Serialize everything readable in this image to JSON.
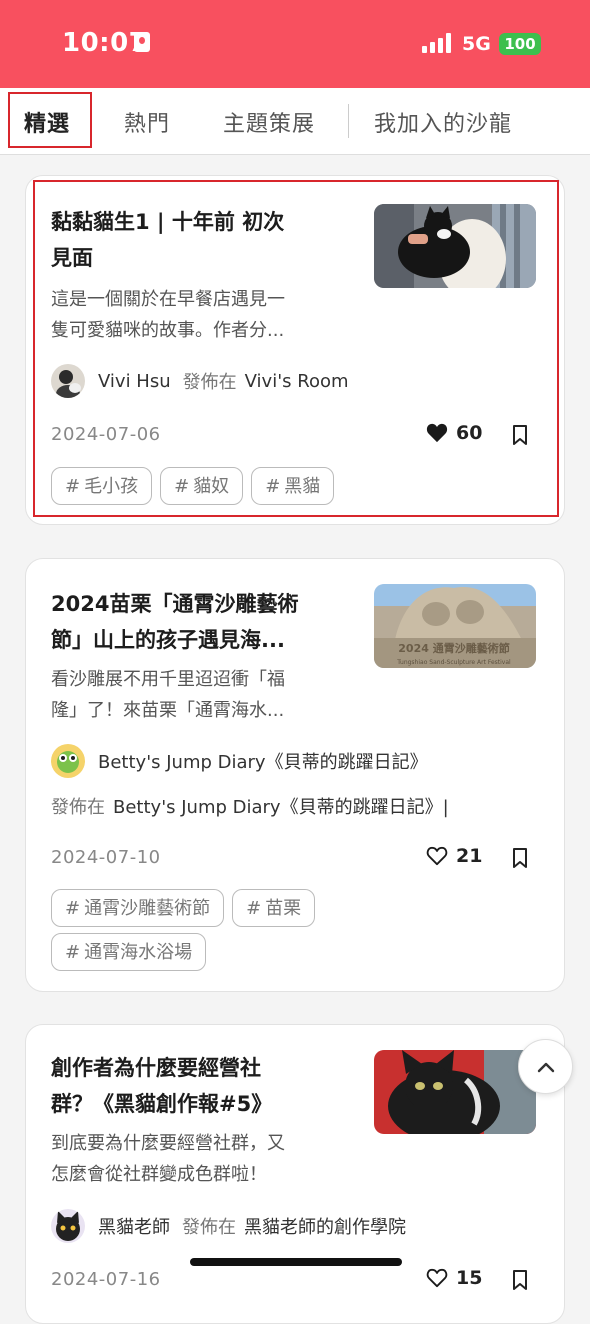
{
  "status_bar": {
    "time": "10:07",
    "network": "5G",
    "battery": "100"
  },
  "tabs": [
    {
      "label": "精選",
      "active": true
    },
    {
      "label": "熱門",
      "active": false
    },
    {
      "label": "主題策展",
      "active": false
    },
    {
      "label": "我加入的沙龍",
      "active": false
    }
  ],
  "posts": [
    {
      "title_lines": [
        "黏黏貓生1 | 十年前 初次",
        "見面"
      ],
      "excerpt_lines": [
        "這是一個關於在早餐店遇見一",
        "隻可愛貓咪的故事。作者分..."
      ],
      "author": "Vivi Hsu",
      "published_label": "發佈在",
      "published_in": "Vivi's Room",
      "date": "2024-07-06",
      "likes": "60",
      "liked": true,
      "tags": [
        "毛小孩",
        "貓奴",
        "黑貓"
      ]
    },
    {
      "title_lines": [
        "2024苗栗「通霄沙雕藝術",
        "節」山上的孩子遇見海..."
      ],
      "excerpt_lines": [
        "看沙雕展不用千里迢迢衝「福",
        "隆」了！來苗栗「通霄海水..."
      ],
      "author": "Betty's Jump Diary《貝蒂的跳躍日記》",
      "published_label": "發佈在",
      "published_in": "Betty's Jump Diary《貝蒂的跳躍日記》|",
      "date": "2024-07-10",
      "likes": "21",
      "liked": false,
      "tags": [
        "通霄沙雕藝術節",
        "苗栗",
        "通霄海水浴場"
      ],
      "thumb_text": [
        "2024 通霄沙雕藝術節",
        "Tungshiao Sand-Sculpture Art Festival"
      ]
    },
    {
      "title_lines": [
        "創作者為什麼要經營社",
        "群？《黑貓創作報#5》"
      ],
      "excerpt_lines": [
        "到底要為什麼要經營社群，又",
        "怎麼會從社群變成色群啦！"
      ],
      "author": "黑貓老師",
      "published_label": "發佈在",
      "published_in": "黑貓老師的創作學院",
      "date": "2024-07-16",
      "likes": "15",
      "liked": false
    }
  ],
  "tag_hash": "#",
  "colors": {
    "brand": "#f8505f",
    "highlight": "#d8262c"
  }
}
